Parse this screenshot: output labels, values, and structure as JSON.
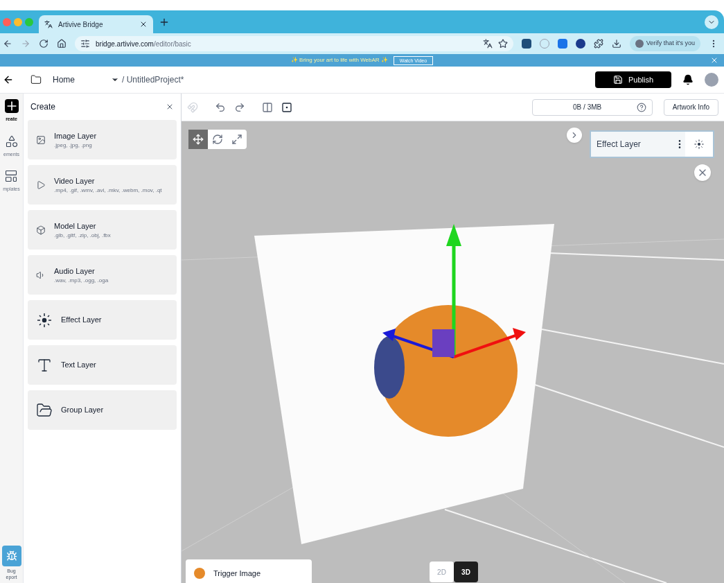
{
  "browser": {
    "tab_title": "Artivive Bridge",
    "url_host": "bridge.artivive.com",
    "url_path": "/editor/basic",
    "profile_label": "Verify that it's you"
  },
  "banner": {
    "text": "✨ Bring your art to life with WebAR ✨",
    "button": "Watch Video"
  },
  "header": {
    "home": "Home",
    "project": "/ UntitledProject*",
    "publish": "Publish"
  },
  "rail": [
    {
      "kind": "create",
      "label": "reate",
      "selected": true
    },
    {
      "kind": "elements",
      "label": "ements",
      "selected": false
    },
    {
      "kind": "templates",
      "label": "mplates",
      "selected": false
    }
  ],
  "bug_report": {
    "lines": [
      "Bug",
      "eport"
    ]
  },
  "panel": {
    "title": "Create",
    "layers": [
      {
        "kind": "image",
        "name": "Image Layer",
        "formats": ".jpeg, .jpg, .png"
      },
      {
        "kind": "video",
        "name": "Video Layer",
        "formats": ".mp4, .gif, .wmv, .avi, .mkv, .webm, .mov, .qt"
      },
      {
        "kind": "model",
        "name": "Model Layer",
        "formats": ".glb, .gltf, .zip, .obj, .fbx"
      },
      {
        "kind": "audio",
        "name": "Audio Layer",
        "formats": ".wav, .mp3, .ogg, .oga"
      },
      {
        "kind": "effect",
        "name": "Effect Layer"
      },
      {
        "kind": "text",
        "name": "Text Layer"
      },
      {
        "kind": "group",
        "name": "Group Layer"
      }
    ]
  },
  "toolbar": {
    "storage": "0B / 3MB",
    "artwork_info": "Artwork Info"
  },
  "viewport": {
    "tools": [
      {
        "kind": "move",
        "selected": true
      },
      {
        "kind": "rotate",
        "selected": false
      },
      {
        "kind": "scale",
        "selected": false
      }
    ],
    "effect_panel": {
      "label": "Effect Layer"
    },
    "trigger": {
      "label": "Trigger Image"
    },
    "view_modes": [
      {
        "label": "2D",
        "selected": false
      },
      {
        "label": "3D",
        "selected": true
      }
    ]
  }
}
